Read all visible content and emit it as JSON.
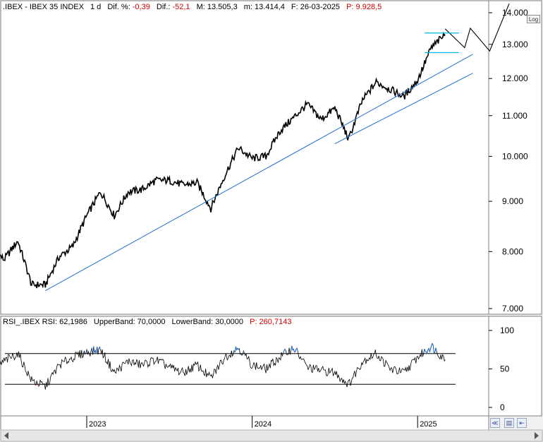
{
  "header": {
    "symbol": ".IBEX - IBEX 35 INDEX",
    "period": "1 d",
    "dif_pct_label": "Dif. %:",
    "dif_pct_value": "-0,39",
    "dif_label": "Dif.:",
    "dif_value": "-52,1",
    "m_label": "M: 13.505,3",
    "m2_label": "m: 13.414,4",
    "f_label": "F: 26-03-2025",
    "p_label": "P: 9.928,5"
  },
  "rsi_header": {
    "title": "RSI_.IBEX RSI: 62,1986",
    "upper": "UpperBand: 70,0000",
    "lower": "LowerBand: 30,0000",
    "p": "P: 260,7143"
  },
  "log_button": "Log",
  "colors": {
    "price": "#000000",
    "trendline": "#1f6fd0",
    "band_line": "#000000",
    "rsi_overbought": "#1f6fd0",
    "rsi_oversold": "#d40000",
    "cyan_level": "#00b7e6"
  },
  "icons": [
    "zoom-icon",
    "save-icon",
    "pin-icon",
    "scroll-left-icon",
    "scroll-right-icon"
  ],
  "chart_data": [
    {
      "type": "line",
      "title": "IBEX 35 INDEX",
      "scale": "log",
      "ylim": [
        7000,
        14000
      ],
      "y_ticks": [
        "14.000",
        "13.000",
        "12.000",
        "11.000",
        "10.000",
        "9.000",
        "8.000",
        "7.000"
      ],
      "x_ticks": [
        "2023",
        "2024",
        "2025"
      ],
      "grid": false,
      "series": [
        {
          "x": [
            "2022-06",
            "2022-07",
            "2022-08",
            "2022-09",
            "2022-10",
            "2022-11",
            "2022-12",
            "2023-01",
            "2023-02",
            "2023-03",
            "2023-04",
            "2023-05",
            "2023-06",
            "2023-07",
            "2023-08",
            "2023-09",
            "2023-10",
            "2023-11",
            "2023-12",
            "2024-01",
            "2024-02",
            "2024-03",
            "2024-04",
            "2024-05",
            "2024-06",
            "2024-07",
            "2024-08",
            "2024-09",
            "2024-10",
            "2024-11",
            "2024-12",
            "2025-01",
            "2025-02",
            "2025-03"
          ],
          "values": [
            8100,
            7850,
            8200,
            7400,
            7400,
            7900,
            8100,
            8700,
            9200,
            8700,
            9200,
            9250,
            9450,
            9450,
            9350,
            9400,
            8850,
            9550,
            10200,
            9950,
            10000,
            10600,
            10950,
            11300,
            10900,
            11200,
            10400,
            11400,
            11900,
            11700,
            11500,
            11950,
            12900,
            13300
          ]
        }
      ],
      "trendlines": [
        {
          "from": [
            "2022-10",
            7300
          ],
          "to": [
            "2025-05",
            12700
          ]
        },
        {
          "from": [
            "2024-07",
            10300
          ],
          "to": [
            "2025-05",
            12150
          ]
        }
      ],
      "projection": {
        "x": [
          "2025-03",
          "2025-04",
          "2025-04",
          "2025-05",
          "2025-06"
        ],
        "values": [
          13480,
          12900,
          13500,
          12800,
          14300
        ]
      },
      "levels": [
        13350,
        12750
      ]
    },
    {
      "type": "line",
      "title": "RSI_.IBEX RSI",
      "ylim": [
        0,
        100
      ],
      "y_ticks": [
        "100",
        "50",
        "0"
      ],
      "bands": {
        "upper": 70,
        "lower": 30
      },
      "series": [
        {
          "name": "RSI",
          "x": [
            "2022-06",
            "2022-07",
            "2022-08",
            "2022-09",
            "2022-10",
            "2022-11",
            "2022-12",
            "2023-01",
            "2023-02",
            "2023-03",
            "2023-04",
            "2023-05",
            "2023-06",
            "2023-07",
            "2023-08",
            "2023-09",
            "2023-10",
            "2023-11",
            "2023-12",
            "2024-01",
            "2024-02",
            "2024-03",
            "2024-04",
            "2024-05",
            "2024-06",
            "2024-07",
            "2024-08",
            "2024-09",
            "2024-10",
            "2024-11",
            "2024-12",
            "2025-01",
            "2025-02",
            "2025-03"
          ],
          "values": [
            45,
            60,
            70,
            35,
            27,
            55,
            65,
            72,
            75,
            45,
            60,
            55,
            62,
            52,
            45,
            55,
            38,
            65,
            78,
            55,
            50,
            65,
            78,
            52,
            48,
            45,
            30,
            60,
            70,
            50,
            45,
            65,
            80,
            62
          ]
        }
      ]
    }
  ]
}
